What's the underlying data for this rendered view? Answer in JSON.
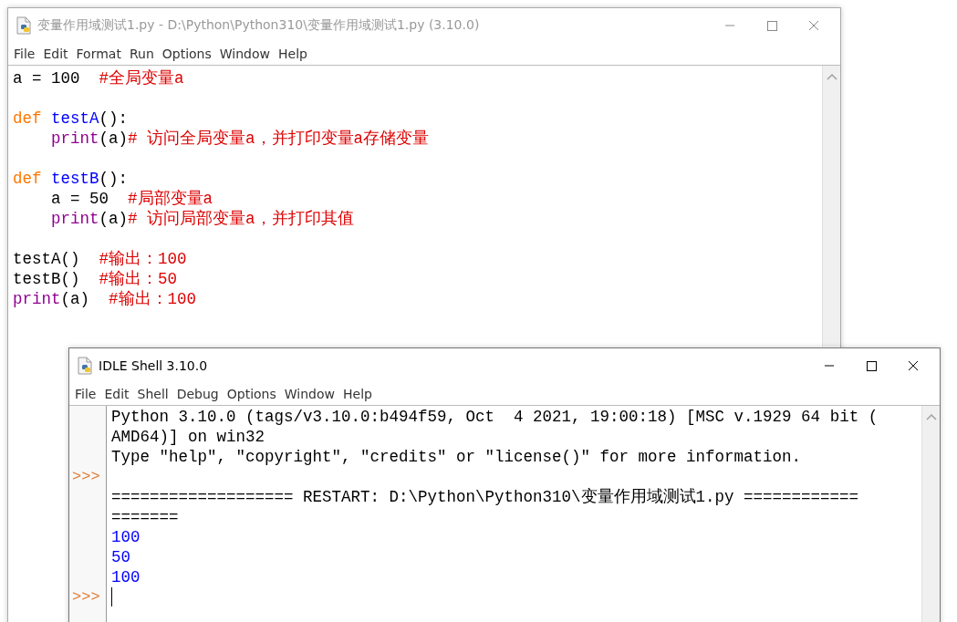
{
  "editor": {
    "title": "变量作用域测试1.py - D:\\Python\\Python310\\变量作用域测试1.py (3.10.0)",
    "active": false,
    "menu": [
      "File",
      "Edit",
      "Format",
      "Run",
      "Options",
      "Window",
      "Help"
    ],
    "lines": [
      {
        "kind": "code",
        "tokens": [
          {
            "kind": "plain",
            "text": "a = 100  "
          },
          {
            "kind": "comment",
            "text": "#全局变量a"
          }
        ]
      },
      {
        "kind": "blank"
      },
      {
        "kind": "code",
        "tokens": [
          {
            "kind": "keyword",
            "text": "def "
          },
          {
            "kind": "definition",
            "text": "testA"
          },
          {
            "kind": "plain",
            "text": "():"
          }
        ]
      },
      {
        "kind": "code",
        "indented": true,
        "tokens": [
          {
            "kind": "builtin",
            "text": "print"
          },
          {
            "kind": "plain",
            "text": "(a)"
          },
          {
            "kind": "comment",
            "text": "# 访问全局变量a，并打印变量a存储变量"
          }
        ]
      },
      {
        "kind": "blank"
      },
      {
        "kind": "code",
        "tokens": [
          {
            "kind": "keyword",
            "text": "def "
          },
          {
            "kind": "definition",
            "text": "testB"
          },
          {
            "kind": "plain",
            "text": "():"
          }
        ]
      },
      {
        "kind": "code",
        "indented": true,
        "tokens": [
          {
            "kind": "plain",
            "text": "a = 50  "
          },
          {
            "kind": "comment",
            "text": "#局部变量a"
          }
        ]
      },
      {
        "kind": "code",
        "indented": true,
        "tokens": [
          {
            "kind": "builtin",
            "text": "print"
          },
          {
            "kind": "plain",
            "text": "(a)"
          },
          {
            "kind": "comment",
            "text": "# 访问局部变量a，并打印其值"
          }
        ]
      },
      {
        "kind": "blank"
      },
      {
        "kind": "code",
        "tokens": [
          {
            "kind": "plain",
            "text": "testA()  "
          },
          {
            "kind": "comment",
            "text": "#输出：100"
          }
        ]
      },
      {
        "kind": "code",
        "tokens": [
          {
            "kind": "plain",
            "text": "testB()  "
          },
          {
            "kind": "comment",
            "text": "#输出：50"
          }
        ]
      },
      {
        "kind": "code",
        "tokens": [
          {
            "kind": "builtin",
            "text": "print"
          },
          {
            "kind": "plain",
            "text": "(a)  "
          },
          {
            "kind": "comment",
            "text": "#输出：100"
          }
        ]
      }
    ]
  },
  "shell": {
    "title": "IDLE Shell 3.10.0",
    "active": true,
    "menu": [
      "File",
      "Edit",
      "Shell",
      "Debug",
      "Options",
      "Window",
      "Help"
    ],
    "lines": [
      {
        "kind": "console",
        "text": "Python 3.10.0 (tags/v3.10.0:b494f59, Oct  4 2021, 19:00:18) [MSC v.1929 64 bit ("
      },
      {
        "kind": "console",
        "text": "AMD64)] on win32"
      },
      {
        "kind": "console",
        "text": "Type \"help\", \"copyright\", \"credits\" or \"license()\" for more information."
      },
      {
        "kind": "blank",
        "prompt": ">>>"
      },
      {
        "kind": "console",
        "text": "=================== RESTART: D:\\Python\\Python310\\变量作用域测试1.py ============"
      },
      {
        "kind": "console",
        "text": "======="
      },
      {
        "kind": "stdout",
        "text": "100"
      },
      {
        "kind": "stdout",
        "text": "50"
      },
      {
        "kind": "stdout",
        "text": "100"
      },
      {
        "kind": "input",
        "prompt": ">>>",
        "cursor": true
      }
    ]
  }
}
